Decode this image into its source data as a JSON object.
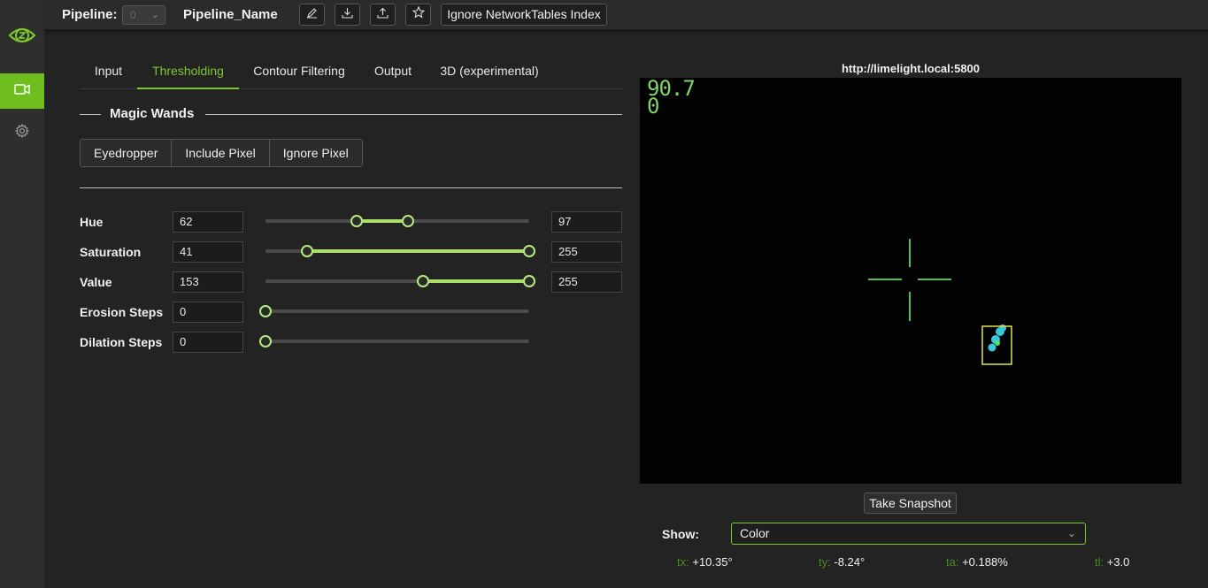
{
  "header": {
    "pipeline_label": "Pipeline:",
    "pipeline_selected": "0",
    "pipeline_name": "Pipeline_Name",
    "ignore_nt_label": "Ignore NetworkTables Index"
  },
  "tabs": [
    {
      "label": "Input"
    },
    {
      "label": "Thresholding"
    },
    {
      "label": "Contour Filtering"
    },
    {
      "label": "Output"
    },
    {
      "label": "3D (experimental)"
    }
  ],
  "magic_wands": {
    "title": "Magic Wands",
    "buttons": [
      "Eyedropper",
      "Include Pixel",
      "Ignore Pixel"
    ]
  },
  "sliders": {
    "hue": {
      "label": "Hue",
      "min": "62",
      "max": "97"
    },
    "saturation": {
      "label": "Saturation",
      "min": "41",
      "max": "255"
    },
    "value": {
      "label": "Value",
      "min": "153",
      "max": "255"
    },
    "erosion": {
      "label": "Erosion Steps",
      "value": "0"
    },
    "dilation": {
      "label": "Dilation Steps",
      "value": "0"
    }
  },
  "stream": {
    "url": "http://limelight.local:5800",
    "osd_line1": "90.7",
    "osd_line2": "0",
    "snapshot_label": "Take Snapshot",
    "show_label": "Show:",
    "show_value": "Color"
  },
  "stats": {
    "tx": {
      "key": "tx:",
      "value": "+10.35°"
    },
    "ty": {
      "key": "ty:",
      "value": "-8.24°"
    },
    "ta": {
      "key": "ta:",
      "value": "+0.188%"
    },
    "tl": {
      "key": "tl:",
      "value": "+3.0"
    }
  },
  "colors": {
    "accent": "#7cc92e",
    "slider_fill": "#a8e06a",
    "crosshair": "#4fc24f",
    "target_box": "#e2e34a",
    "blob": "#38c8d6"
  }
}
